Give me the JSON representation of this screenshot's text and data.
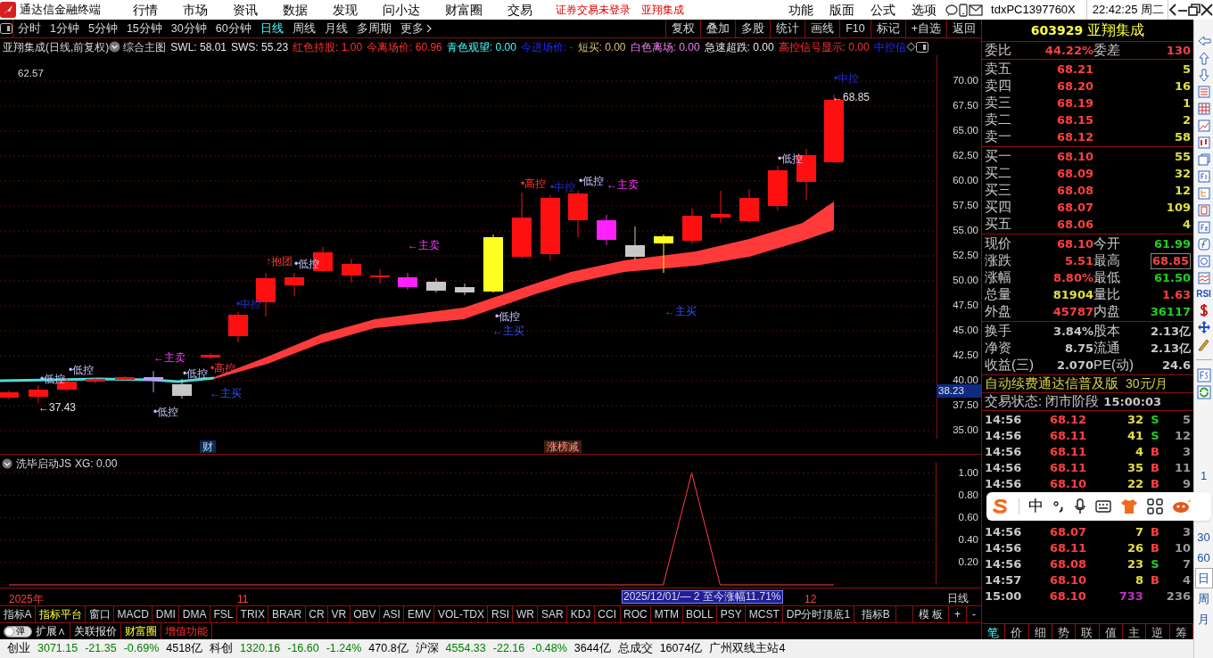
{
  "title_bar": {
    "app_name": "通达信金融终端",
    "menu": [
      "行情",
      "市场",
      "资讯",
      "数据",
      "发现",
      "问小达",
      "财富圈",
      "交易"
    ],
    "notices": [
      "证券交易未登录",
      "亚翔集成"
    ],
    "menu_right": [
      "功能",
      "版面",
      "公式",
      "选项"
    ],
    "account": "tdxPC1397760X",
    "clock": "22:42:25 周二"
  },
  "periods": [
    {
      "label": "分时",
      "selected": false
    },
    {
      "label": "1分钟",
      "selected": false
    },
    {
      "label": "5分钟",
      "selected": false
    },
    {
      "label": "15分钟",
      "selected": false
    },
    {
      "label": "30分钟",
      "selected": false
    },
    {
      "label": "60分钟",
      "selected": false
    },
    {
      "label": "日线",
      "selected": true
    },
    {
      "label": "周线",
      "selected": false
    },
    {
      "label": "月线",
      "selected": false
    },
    {
      "label": "多周期",
      "selected": false
    },
    {
      "label": "更多",
      "selected": false
    }
  ],
  "chart_tools": [
    "复权",
    "叠加",
    "多股",
    "统计",
    "画线",
    "F10",
    "标记",
    "+自选",
    "返回"
  ],
  "info_line": {
    "stock": "亚翔集成(日线,前复权)",
    "template": "综合主图",
    "values": [
      {
        "text": "SWL: 58.01",
        "kind": "line"
      },
      {
        "text": "SWS: 55.23",
        "kind": "line"
      },
      {
        "text": "红色持股: 1.00",
        "kind": "hold"
      },
      {
        "text": "今离场价: 60.96",
        "kind": "hold"
      },
      {
        "text": "青色观望: 0.00",
        "kind": "watch"
      },
      {
        "text": "今进场价: -",
        "kind": "entry"
      },
      {
        "text": "短买: 0.00",
        "kind": "short_buy"
      },
      {
        "text": "白色离场: 0.00",
        "kind": "leave"
      },
      {
        "text": "急速超跌: 0.00",
        "kind": "line"
      },
      {
        "text": "高控信号显示: 0.00",
        "kind": "hold"
      },
      {
        "text": "中控信",
        "kind": "entry"
      }
    ]
  },
  "chart": {
    "high_label": "62.57",
    "price_axis": [
      "70.00",
      "67.50",
      "65.00",
      "62.50",
      "60.00",
      "57.50",
      "55.00",
      "52.50",
      "50.00",
      "47.50",
      "45.00",
      "42.50",
      "40.00",
      "37.50",
      "35.00"
    ],
    "current_price_tag": "38.23",
    "annotations": [
      {
        "text": "•低控",
        "kind": "low"
      },
      {
        "text": "•低控",
        "kind": "low"
      },
      {
        "text": "←37.43",
        "kind": "price"
      },
      {
        "text": "←主卖",
        "kind": "sell"
      },
      {
        "text": "•低控",
        "kind": "low"
      },
      {
        "text": "•高控",
        "kind": "high"
      },
      {
        "text": "•低控",
        "kind": "low"
      },
      {
        "text": "←主买",
        "kind": "buy"
      },
      {
        "text": "•中控",
        "kind": "mid"
      },
      {
        "text": "↑抱团",
        "kind": "high"
      },
      {
        "text": "•低控",
        "kind": "low"
      },
      {
        "text": "←主卖",
        "kind": "sell"
      },
      {
        "text": "•低控",
        "kind": "low"
      },
      {
        "text": "←主买",
        "kind": "buy"
      },
      {
        "text": "•高控",
        "kind": "high"
      },
      {
        "text": "•中控",
        "kind": "mid"
      },
      {
        "text": "•低控",
        "kind": "low"
      },
      {
        "text": "←主卖",
        "kind": "sell"
      },
      {
        "text": "←主买",
        "kind": "buy"
      },
      {
        "text": "•低控",
        "kind": "low"
      },
      {
        "text": "•中控",
        "kind": "mid"
      },
      {
        "text": "←68.85",
        "kind": "price"
      }
    ],
    "markers": [
      {
        "text": "财",
        "kind": "finance"
      },
      {
        "text": "涨榜减",
        "kind": "ranking"
      }
    ]
  },
  "indicator": {
    "title": "洗毕启动JS",
    "value": ": 0.00",
    "chart_data": {
      "type": "line",
      "series": [
        {
          "name": "XG",
          "color": "#ff4040",
          "values": [
            0,
            0,
            0,
            0,
            0,
            0,
            0,
            0,
            0,
            0,
            0,
            0,
            0,
            0,
            0,
            0,
            0,
            0,
            0,
            0,
            0,
            0,
            0,
            0,
            1,
            0,
            0,
            0,
            0,
            0
          ]
        }
      ],
      "ylim": [
        0,
        1.1
      ],
      "grid": true,
      "yticks": [
        {
          "value": 0.2,
          "label": "0.20"
        },
        {
          "value": 0.4,
          "label": "0.40"
        },
        {
          "value": 0.6,
          "label": "0.60"
        },
        {
          "value": 0.8,
          "label": "0.80"
        },
        {
          "value": 1.0,
          "label": "1.00"
        }
      ]
    }
  },
  "date_axis": {
    "labels": [
      "2025年",
      "11",
      "12"
    ],
    "range_note": "2025/12/01/— 2 至今涨幅11.71%",
    "period": "日线"
  },
  "indicator_tabs": [
    {
      "label": "指标A",
      "selected": false
    },
    {
      "label": "指标平台",
      "selected": true
    },
    {
      "label": "窗口",
      "selected": false
    },
    {
      "label": "MACD",
      "selected": false
    },
    {
      "label": "DMI",
      "selected": false
    },
    {
      "label": "DMA",
      "selected": false
    },
    {
      "label": "FSL",
      "selected": false
    },
    {
      "label": "TRIX",
      "selected": false
    },
    {
      "label": "BRAR",
      "selected": false
    },
    {
      "label": "CR",
      "selected": false
    },
    {
      "label": "VR",
      "selected": false
    },
    {
      "label": "OBV",
      "selected": false
    },
    {
      "label": "ASI",
      "selected": false
    },
    {
      "label": "EMV",
      "selected": false
    },
    {
      "label": "VOL-TDX",
      "selected": false
    },
    {
      "label": "RSI",
      "selected": false
    },
    {
      "label": "WR",
      "selected": false
    },
    {
      "label": "SAR",
      "selected": false
    },
    {
      "label": "KDJ",
      "selected": false
    },
    {
      "label": "CCI",
      "selected": false
    },
    {
      "label": "ROC",
      "selected": false
    },
    {
      "label": "MTM",
      "selected": false
    },
    {
      "label": "BOLL",
      "selected": false
    },
    {
      "label": "PSY",
      "selected": false
    },
    {
      "label": "MCST",
      "selected": false
    },
    {
      "label": "DP分时顶底1",
      "selected": false
    }
  ],
  "indicator_tabs_right": [
    "指标B",
    "模 板",
    "+",
    "-"
  ],
  "bottom_links": {
    "toggle": {
      "label": "弹",
      "on": false
    },
    "links": [
      {
        "text": "扩展∧",
        "kind": "plain"
      },
      {
        "text": "关联报价",
        "kind": "plain"
      },
      {
        "text": "财富圈",
        "kind": "highlight"
      },
      {
        "text": "增值功能",
        "kind": "promo"
      }
    ]
  },
  "status_bar": [
    {
      "text": "创业",
      "kind": "plain"
    },
    {
      "text": "3071.15",
      "kind": "down"
    },
    {
      "text": "-21.35",
      "kind": "down"
    },
    {
      "text": "-0.69%",
      "kind": "down"
    },
    {
      "text": "4518亿",
      "kind": "plain"
    },
    {
      "text": "科创",
      "kind": "plain"
    },
    {
      "text": "1320.16",
      "kind": "down"
    },
    {
      "text": "-16.60",
      "kind": "down"
    },
    {
      "text": "-1.24%",
      "kind": "down"
    },
    {
      "text": "470.8亿",
      "kind": "plain"
    },
    {
      "text": "沪深",
      "kind": "plain"
    },
    {
      "text": "4554.33",
      "kind": "down"
    },
    {
      "text": "-22.16",
      "kind": "down"
    },
    {
      "text": "-0.48%",
      "kind": "down"
    },
    {
      "text": "3644亿",
      "kind": "plain"
    },
    {
      "text": "总成交",
      "kind": "plain"
    },
    {
      "text": "16074亿",
      "kind": "plain"
    },
    {
      "text": "广州双线主站4",
      "kind": "plain"
    }
  ],
  "quote": {
    "code": "603929",
    "name": "亚翔集成",
    "ratio": {
      "label": "委比",
      "value": "44.22%",
      "label2": "委差",
      "value2": "130"
    },
    "asks": [
      {
        "label": "卖五",
        "price": "68.21",
        "volume": "5"
      },
      {
        "label": "卖四",
        "price": "68.20",
        "volume": "16"
      },
      {
        "label": "卖三",
        "price": "68.19",
        "volume": "1"
      },
      {
        "label": "卖二",
        "price": "68.15",
        "volume": "2"
      },
      {
        "label": "卖一",
        "price": "68.12",
        "volume": "58"
      }
    ],
    "bids": [
      {
        "label": "买一",
        "price": "68.10",
        "volume": "55"
      },
      {
        "label": "买二",
        "price": "68.09",
        "volume": "32"
      },
      {
        "label": "买三",
        "price": "68.08",
        "volume": "12"
      },
      {
        "label": "买四",
        "price": "68.07",
        "volume": "109"
      },
      {
        "label": "买五",
        "price": "68.06",
        "volume": "4"
      }
    ],
    "stats": [
      {
        "left": {
          "label": "现价",
          "value": "68.10",
          "color": "#ff4040"
        },
        "right": {
          "label": "今开",
          "value": "61.99",
          "color": "#20d020"
        }
      },
      {
        "left": {
          "label": "涨跌",
          "value": "5.51",
          "color": "#ff4040"
        },
        "right": {
          "label": "最高",
          "value": "68.85",
          "color": "#ff4040",
          "boxed": true
        }
      },
      {
        "left": {
          "label": "涨幅",
          "value": "8.80%",
          "color": "#ff4040"
        },
        "right": {
          "label": "最低",
          "value": "61.50",
          "color": "#20d020"
        }
      },
      {
        "left": {
          "label": "总量",
          "value": "81904",
          "color": "#e0e040"
        },
        "right": {
          "label": "量比",
          "value": "1.63",
          "color": "#ff4040"
        }
      },
      {
        "left": {
          "label": "外盘",
          "value": "45787",
          "color": "#ff4040"
        },
        "right": {
          "label": "内盘",
          "value": "36117",
          "color": "#20d020"
        }
      }
    ],
    "fundamentals": [
      {
        "label": "换手",
        "value": "3.84%",
        "label2": "股本",
        "value2": "2.13亿"
      },
      {
        "label": "净资",
        "value": "8.75",
        "label2": "流通",
        "value2": "2.13亿"
      },
      {
        "label": "收益(三)",
        "value": "2.070",
        "label2": "PE(动)",
        "value2": "24.6"
      }
    ],
    "promo": {
      "text": "自动续费通达信普及版",
      "price": "30元/月"
    },
    "trade_status": {
      "label": "交易状态: 闭市阶段",
      "time": "15:00:03"
    },
    "trades": [
      {
        "time": "14:56",
        "price": "68.12",
        "volume": "32",
        "side": "S",
        "count": "5"
      },
      {
        "time": "14:56",
        "price": "68.11",
        "volume": "41",
        "side": "S",
        "count": "12"
      },
      {
        "time": "14:56",
        "price": "68.11",
        "volume": "4",
        "side": "B",
        "count": "3"
      },
      {
        "time": "14:56",
        "price": "68.11",
        "volume": "35",
        "side": "B",
        "count": "11"
      },
      {
        "time": "14:56",
        "price": "68.10",
        "volume": "22",
        "side": "B",
        "count": "9"
      },
      {
        "kind": "hidden"
      },
      {
        "kind": "hidden"
      },
      {
        "time": "14:56",
        "price": "68.07",
        "volume": "7",
        "side": "B",
        "count": "3"
      },
      {
        "time": "14:56",
        "price": "68.11",
        "volume": "26",
        "side": "B",
        "count": "10"
      },
      {
        "time": "14:56",
        "price": "68.08",
        "volume": "23",
        "side": "S",
        "count": "7"
      },
      {
        "time": "14:57",
        "price": "68.10",
        "volume": "8",
        "side": "B",
        "count": "4"
      },
      {
        "time": "15:00",
        "price": "68.10",
        "volume": "733",
        "count": "236",
        "kind": "close"
      }
    ],
    "tabs": [
      "笔",
      "价",
      "细",
      "势",
      "联",
      "值",
      "主",
      "逆",
      "筹"
    ]
  },
  "sidebar": {
    "rsi_label": "RSI",
    "periods": [
      {
        "label": "1",
        "selected": false
      },
      {
        "label": "30",
        "selected": false
      },
      {
        "label": "60",
        "selected": false
      },
      {
        "label": "日",
        "selected": true
      },
      {
        "label": "周",
        "selected": false
      },
      {
        "label": "月",
        "selected": false
      }
    ]
  },
  "ime_toolbar": {
    "mode": "中"
  }
}
